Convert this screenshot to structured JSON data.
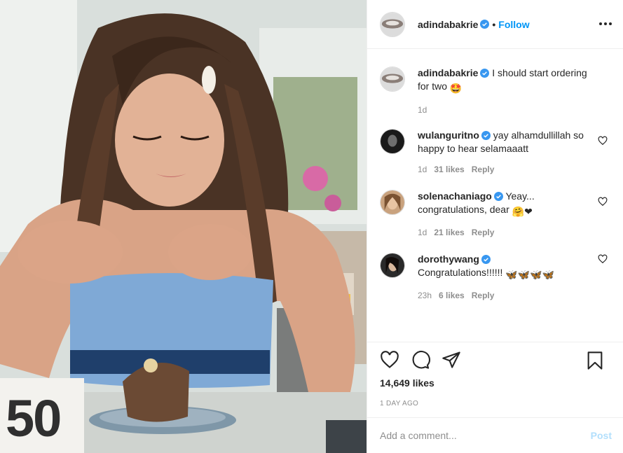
{
  "post": {
    "author": "adindabakrie",
    "follow_label": "Follow",
    "dot": "•",
    "caption": "I should start ordering for two",
    "caption_emoji": "🤩",
    "caption_age": "1d",
    "photo_card_number": "50",
    "likes": "14,649 likes",
    "date": "1 DAY AGO"
  },
  "comments": [
    {
      "user": "wulanguritno",
      "text": "yay alhamdullillah so happy to hear selamaaatt",
      "age": "1d",
      "likes": "31 likes",
      "reply": "Reply"
    },
    {
      "user": "solenachaniago",
      "text": "Yeay... congratulations, dear",
      "emojis": "🤗❤",
      "age": "1d",
      "likes": "21 likes",
      "reply": "Reply"
    },
    {
      "user": "dorothywang",
      "text": "Congratulations!!!!!!",
      "emojis": "🦋🦋🦋🦋",
      "age": "23h",
      "likes": "6 likes",
      "reply": "Reply"
    }
  ],
  "composer": {
    "placeholder": "Add a comment...",
    "post_label": "Post"
  },
  "colors": {
    "accent": "#0095f6",
    "muted": "#8e8e8e",
    "post_disabled": "#b2dffc",
    "verified": "#3897f0"
  },
  "icons": [
    "heart-icon",
    "comment-icon",
    "share-icon",
    "bookmark-icon",
    "more-options-icon",
    "verified-badge-icon"
  ]
}
